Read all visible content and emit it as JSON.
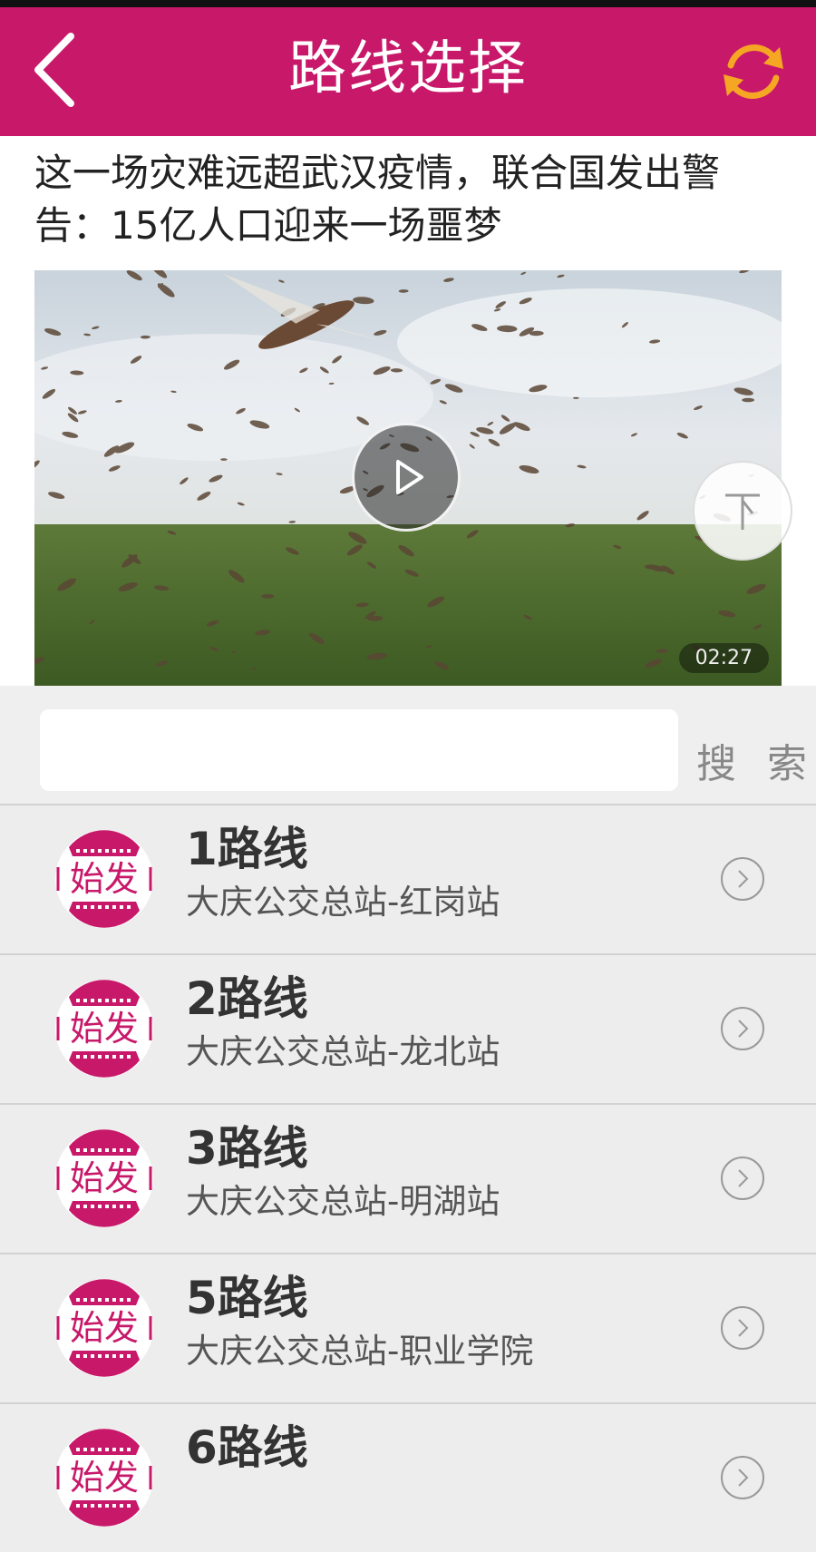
{
  "header": {
    "title": "路线选择",
    "back_icon": "chevron-left-icon",
    "refresh_icon": "refresh-icon"
  },
  "ad": {
    "headline": "这一场灾难远超武汉疫情，联合国发出警告：15亿人口迎来一场噩梦",
    "duration": "02:27"
  },
  "search": {
    "input_value": "",
    "button_label": "搜 索"
  },
  "routes": [
    {
      "badge": "始发",
      "name": "1路线",
      "desc": "大庆公交总站-红岗站"
    },
    {
      "badge": "始发",
      "name": "2路线",
      "desc": "大庆公交总站-龙北站"
    },
    {
      "badge": "始发",
      "name": "3路线",
      "desc": "大庆公交总站-明湖站"
    },
    {
      "badge": "始发",
      "name": "5路线",
      "desc": "大庆公交总站-职业学院"
    },
    {
      "badge": "始发",
      "name": "6路线",
      "desc": ""
    }
  ],
  "colors": {
    "header_bg": "#c8186a",
    "badge_color": "#c8186a",
    "refresh_color": "#f5a623"
  }
}
